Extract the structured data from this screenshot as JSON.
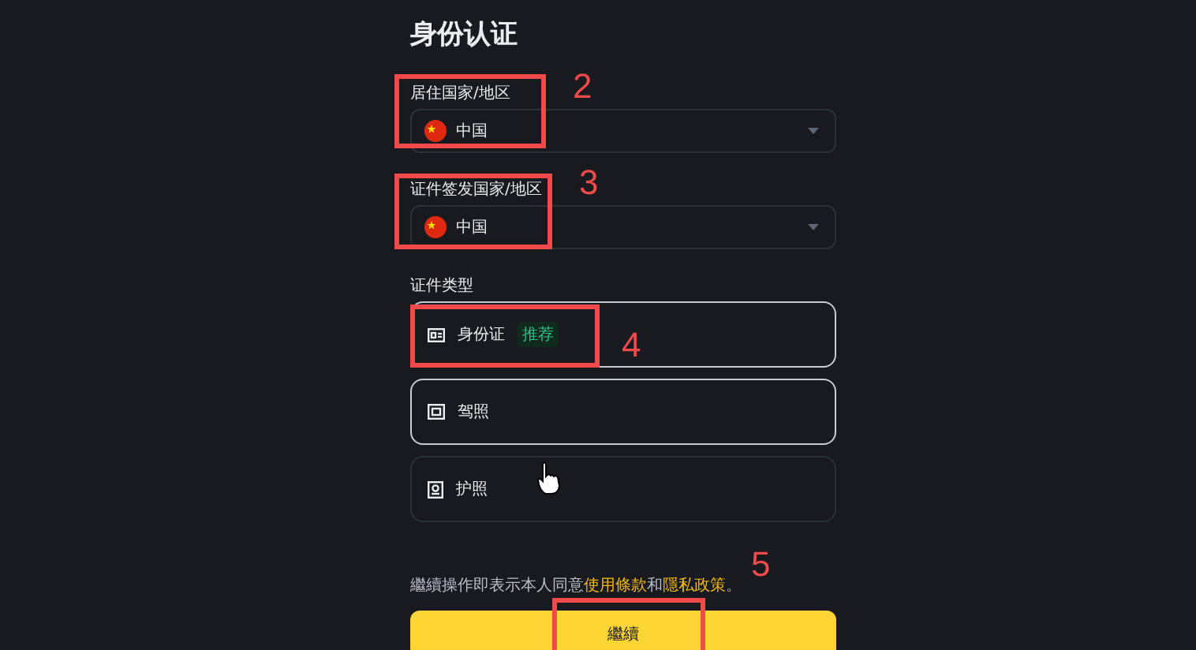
{
  "title": "身份认证",
  "residence": {
    "label": "居住国家/地区",
    "value": "中国"
  },
  "issuing": {
    "label": "证件签发国家/地区",
    "value": "中国"
  },
  "document_type": {
    "label": "证件类型",
    "options": [
      {
        "kind": "id-card",
        "label": "身份证",
        "badge": "推荐",
        "highlighted": true
      },
      {
        "kind": "license",
        "label": "驾照",
        "highlighted": true
      },
      {
        "kind": "passport",
        "label": "护照",
        "highlighted": false
      }
    ]
  },
  "terms": {
    "prefix": "繼續操作即表示本人同意",
    "link_1": "使用條款",
    "joiner": "和",
    "link_2": "隱私政策",
    "suffix": "。"
  },
  "continue_button": "繼續",
  "annotations": [
    {
      "number": "2"
    },
    {
      "number": "3"
    },
    {
      "number": "4"
    },
    {
      "number": "5"
    }
  ]
}
